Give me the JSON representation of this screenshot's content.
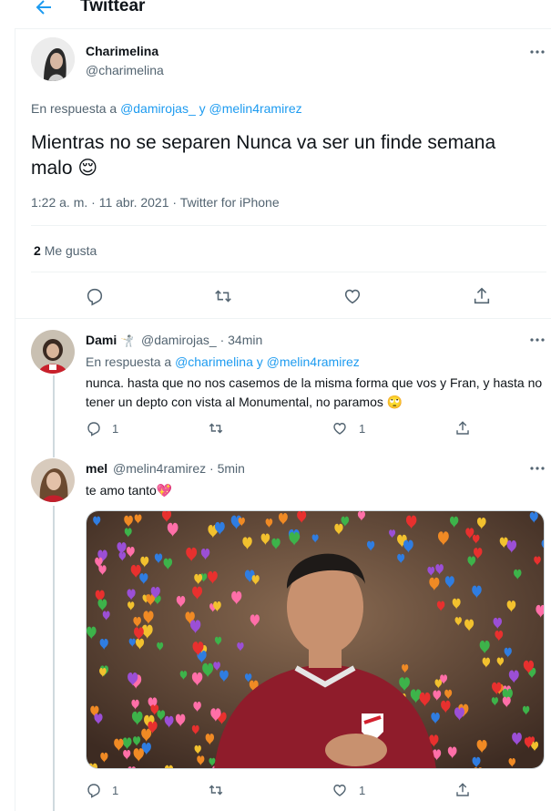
{
  "header": {
    "title": "Twittear"
  },
  "main_tweet": {
    "name": "Charimelina",
    "handle": "@charimelina",
    "reply_prefix": "En respuesta a",
    "reply_mention1": "@damirojas_",
    "reply_and": "y",
    "reply_mention2": "@melin4ramirez",
    "text": "Mientras no se separen Nunca va ser un finde semana malo 😌",
    "meta": "1:22 a. m. · 11 abr. 2021 · Twitter for iPhone",
    "likes_count": "2",
    "likes_label": "Me gusta"
  },
  "reply1": {
    "name": "Dami",
    "name_emoji": "🤺",
    "handle_time": "@damirojas_ · 34min",
    "reply_prefix": "En respuesta a",
    "reply_mentions": "@charimelina y @melin4ramirez",
    "text": "nunca. hasta que no nos casemos de la misma forma que vos y Fran, y hasta no tener un depto con vista al Monumental, no paramos 🙄",
    "reply_count": "1",
    "like_count": "1"
  },
  "reply2": {
    "name": "mel",
    "handle_time": "@melin4ramirez · 5min",
    "text": "te amo tanto💖",
    "reply_count": "1",
    "like_count": "1"
  },
  "colors": {
    "accent": "#1d9bf0",
    "text": "#0f1419",
    "muted": "#536471",
    "border": "#eff3f4",
    "jersey": "#9b1b2a"
  },
  "icons": [
    "back-arrow-icon",
    "more-icon",
    "reply-icon",
    "retweet-icon",
    "like-icon",
    "share-icon"
  ]
}
